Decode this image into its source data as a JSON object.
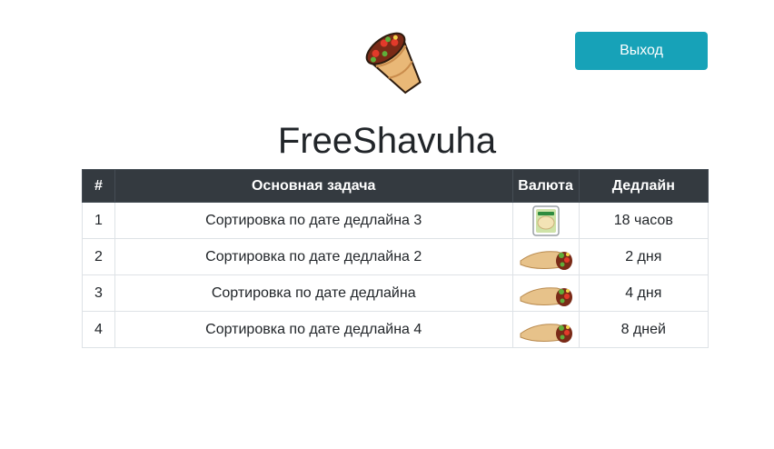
{
  "header": {
    "logo_icon": "shawarma-icon",
    "logout_label": "Выход"
  },
  "title": "FreeShavuha",
  "table": {
    "columns": [
      "#",
      "Основная задача",
      "Валюта",
      "Дедлайн"
    ],
    "rows": [
      {
        "num": "1",
        "task": "Сортировка по дате дедлайна 3",
        "currency_icon": "pita-package-icon",
        "deadline": "18 часов"
      },
      {
        "num": "2",
        "task": "Сортировка по дате дедлайна 2",
        "currency_icon": "shawarma-roll-icon",
        "deadline": "2 дня"
      },
      {
        "num": "3",
        "task": "Сортировка по дате дедлайна",
        "currency_icon": "shawarma-roll-icon",
        "deadline": "4 дня"
      },
      {
        "num": "4",
        "task": "Сортировка по дате дедлайна 4",
        "currency_icon": "shawarma-roll-icon",
        "deadline": "8 дней"
      }
    ]
  },
  "colors": {
    "accent": "#17a2b8",
    "table_header": "#343a40",
    "border": "#dee2e6"
  }
}
